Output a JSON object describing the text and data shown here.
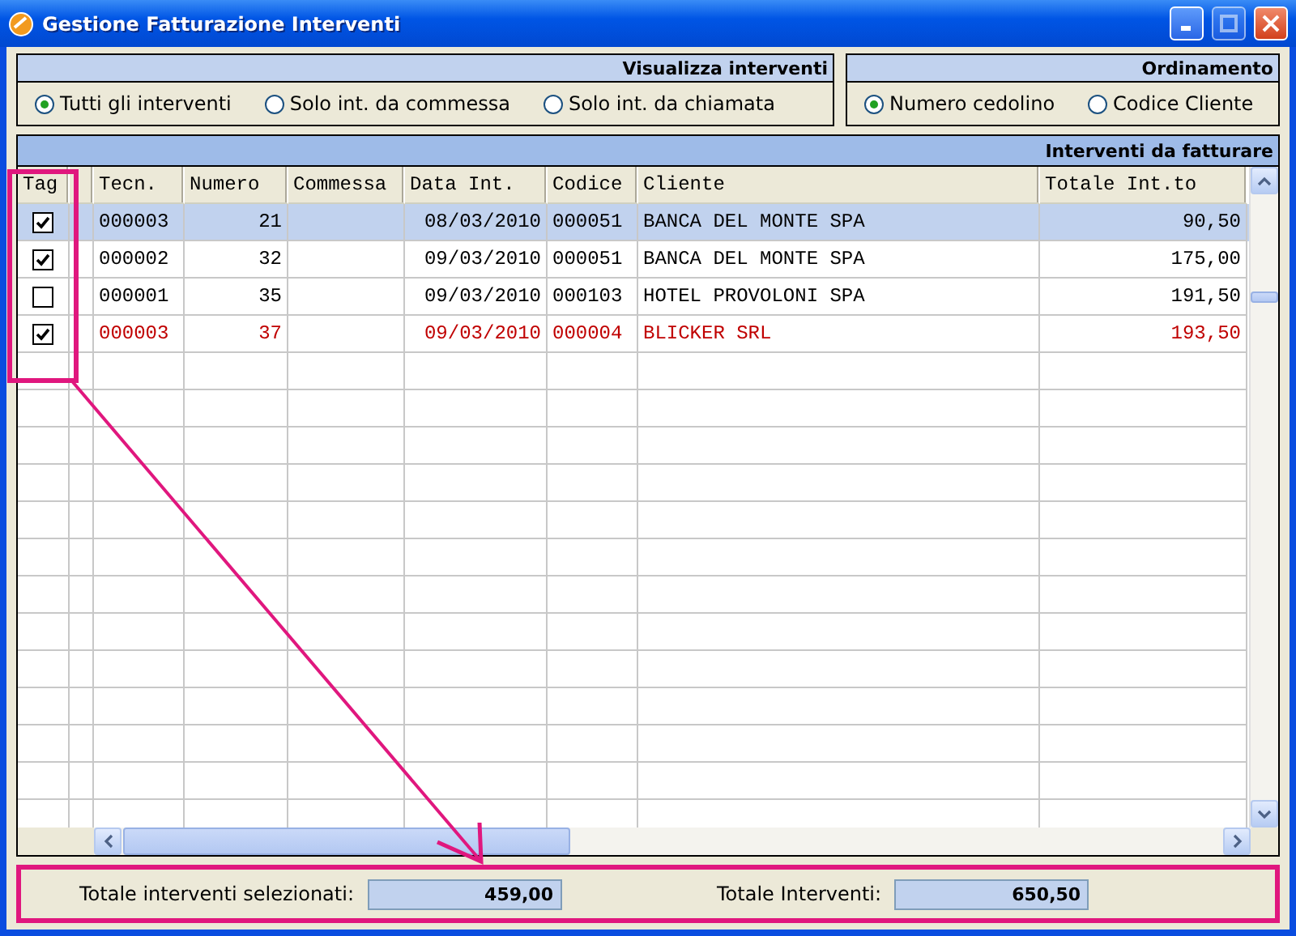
{
  "window": {
    "title": "Gestione Fatturazione Interventi"
  },
  "view_group": {
    "title": "Visualizza interventi",
    "options": [
      {
        "label": "Tutti gli interventi",
        "selected": true
      },
      {
        "label": "Solo int. da commessa",
        "selected": false
      },
      {
        "label": "Solo int. da chiamata",
        "selected": false
      }
    ]
  },
  "order_group": {
    "title": "Ordinamento",
    "options": [
      {
        "label": "Numero cedolino",
        "selected": true
      },
      {
        "label": "Codice Cliente",
        "selected": false
      }
    ]
  },
  "table": {
    "title": "Interventi da fatturare",
    "tag_column": {
      "label": "Tag"
    },
    "columns": [
      {
        "label": "Tecn."
      },
      {
        "label": "Numero"
      },
      {
        "label": "Commessa"
      },
      {
        "label": "Data Int."
      },
      {
        "label": "Codice"
      },
      {
        "label": "Cliente"
      },
      {
        "label": "Totale Int.to"
      }
    ],
    "rows": [
      {
        "checked": true,
        "selected": true,
        "color": "#000000",
        "cells": [
          "000003",
          "21",
          "",
          "08/03/2010",
          "000051",
          "BANCA DEL MONTE SPA",
          "90,50"
        ]
      },
      {
        "checked": true,
        "selected": false,
        "color": "#000000",
        "cells": [
          "000002",
          "32",
          "",
          "09/03/2010",
          "000051",
          "BANCA DEL MONTE SPA",
          "175,00"
        ]
      },
      {
        "checked": false,
        "selected": false,
        "color": "#000000",
        "cells": [
          "000001",
          "35",
          "",
          "09/03/2010",
          "000103",
          "HOTEL PROVOLONI SPA",
          "191,50"
        ]
      },
      {
        "checked": true,
        "selected": false,
        "color": "#c00000",
        "cells": [
          "000003",
          "37",
          "",
          "09/03/2010",
          "000004",
          "BLICKER SRL",
          "193,50"
        ]
      }
    ]
  },
  "totals": [
    {
      "label": "Totale interventi selezionati:",
      "value": "459,00"
    },
    {
      "label": "Totale Interventi:",
      "value": "650,50"
    }
  ]
}
